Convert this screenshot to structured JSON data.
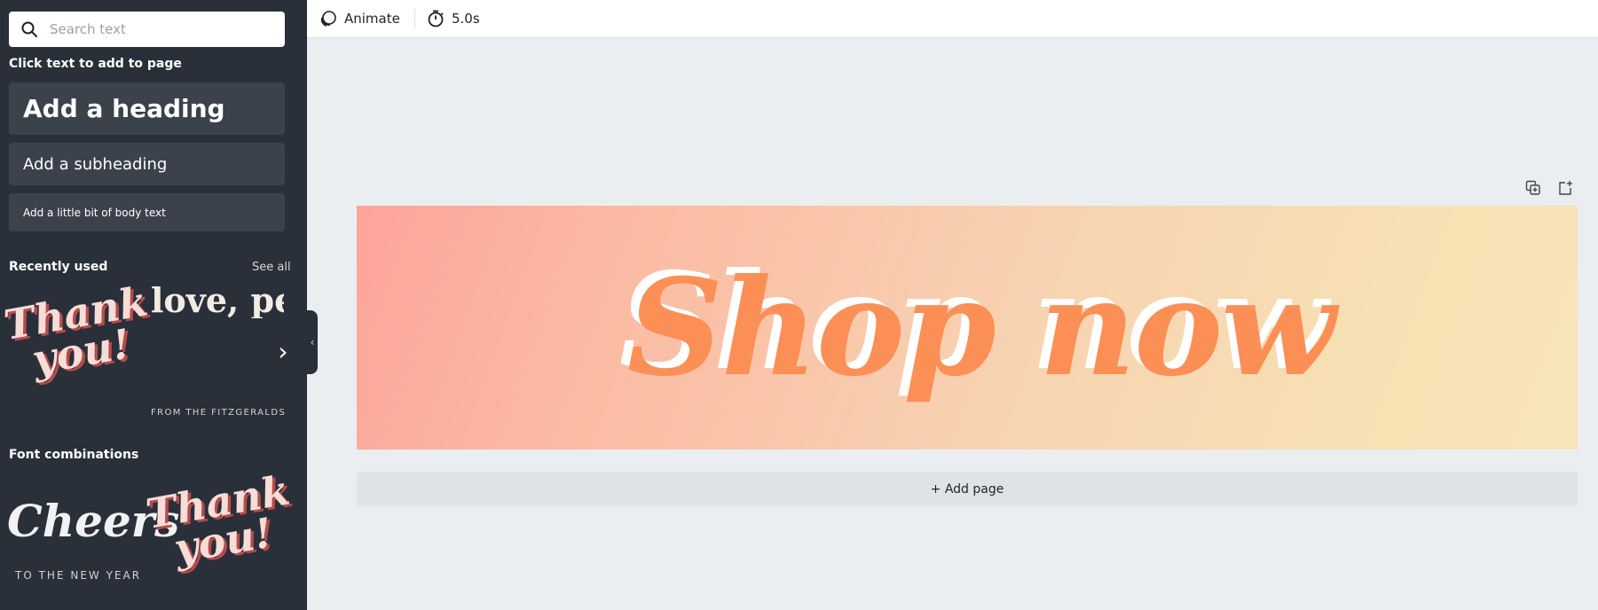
{
  "sidebar": {
    "search": {
      "placeholder": "Search text",
      "value": ""
    },
    "click_to_add_title": "Click text to add to page",
    "heading_label": "Add a heading",
    "subheading_label": "Add a subheading",
    "body_label": "Add a little bit of body text",
    "recently_used": {
      "title": "Recently used",
      "see_all": "See all",
      "items": [
        {
          "text": "Thank you!"
        },
        {
          "text": "love, peace, and joy",
          "caption": "FROM THE FITZGERALDS"
        }
      ]
    },
    "font_combinations": {
      "title": "Font combinations",
      "items": [
        {
          "text": "Cheers",
          "caption": "TO THE NEW YEAR"
        },
        {
          "text": "Thank you!"
        }
      ]
    }
  },
  "toolbar": {
    "animate_label": "Animate",
    "duration_label": "5.0s"
  },
  "canvas": {
    "design_text": "Shop now",
    "add_page_label": "+ Add page",
    "gradient_colors": [
      "#fda49a",
      "#f7e4b8"
    ],
    "text_color": "#fb8f55"
  }
}
